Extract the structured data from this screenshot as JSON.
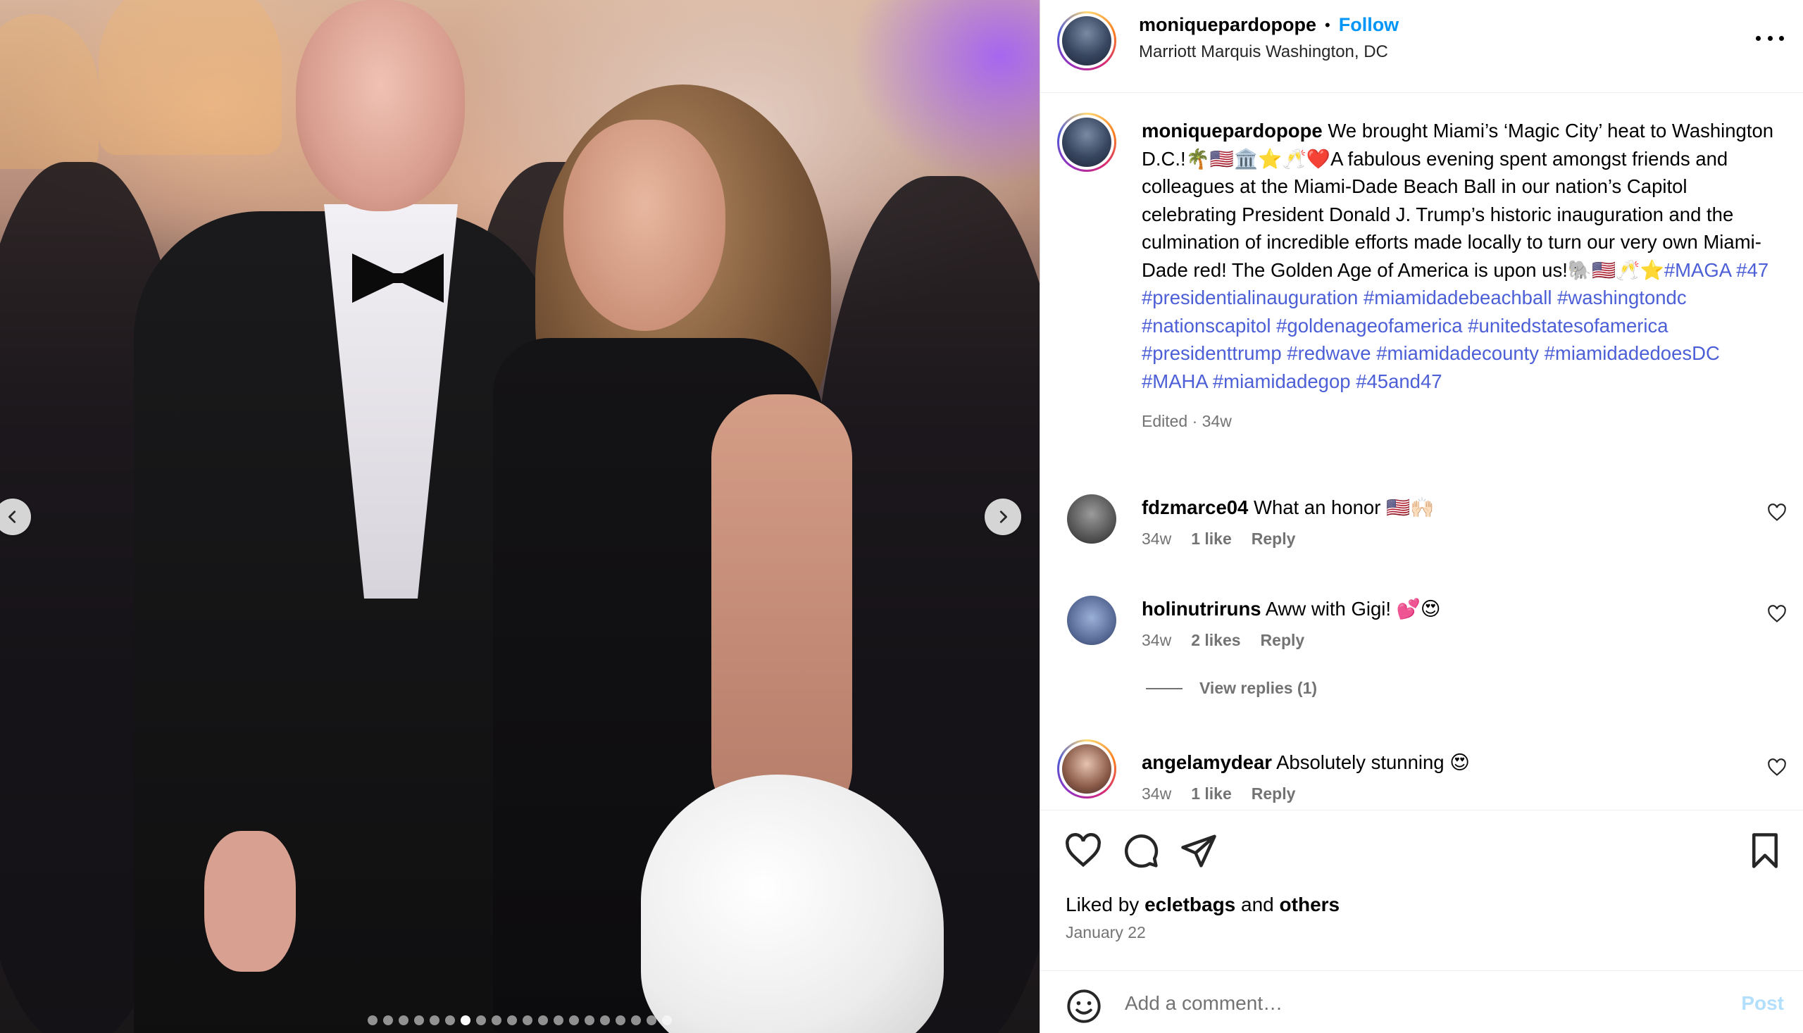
{
  "post": {
    "username": "moniquepardopope",
    "follow_label": "Follow",
    "separator": "•",
    "location": "Marriott Marquis Washington, DC",
    "caption_text": "We brought Miami’s ‘Magic City’ heat to Washington D.C.!🌴🇺🇸🏛️⭐🥂❤️A fabulous evening spent amongst friends and colleagues at the Miami-Dade Beach Ball in our nation’s Capitol celebrating President Donald J. Trump’s historic inauguration and the culmination of incredible efforts made locally to turn our very own Miami-Dade red! The Golden Age of America is upon us!🐘🇺🇸🥂⭐",
    "caption_tags": "#MAGA #47 #presidentialinauguration #miamidadebeachball #washingtondc #nationscapitol #goldenageofamerica #unitedstatesofamerica #presidenttrump #redwave #miamidadecounty #miamidadedoesDC #MAHA #miamidadegop #45and47",
    "caption_meta": "Edited · 34w",
    "carousel": {
      "total_slides": 20,
      "active_index": 6
    }
  },
  "comments": [
    {
      "username": "fdzmarce04",
      "text": "What an honor 🇺🇸🙌🏻",
      "age": "34w",
      "likes": "1 like",
      "reply": "Reply"
    },
    {
      "username": "holinutriruns",
      "text": "Aww with Gigi! 💕😍",
      "age": "34w",
      "likes": "2 likes",
      "reply": "Reply"
    },
    {
      "username": "angelamydear",
      "text": "Absolutely stunning 😍",
      "age": "34w",
      "likes": "1 like",
      "reply": "Reply"
    }
  ],
  "view_replies": "View replies (1)",
  "likes_summary": {
    "prefix": "Liked by",
    "user": "ecletbags",
    "mid": "and",
    "others": "others"
  },
  "post_date": "January 22",
  "add_comment": {
    "placeholder": "Add a comment…",
    "post_label": "Post"
  },
  "icons": [
    "more-options-icon",
    "like-heart-icon",
    "comment-icon",
    "share-icon",
    "save-bookmark-icon",
    "emoji-icon",
    "chevron-left-icon",
    "chevron-right-icon"
  ],
  "colors": {
    "follow_blue": "#0095f6",
    "hashtag_blue": "#4c5fd7",
    "muted_gray": "#737373",
    "post_disabled": "#b2dffc"
  }
}
